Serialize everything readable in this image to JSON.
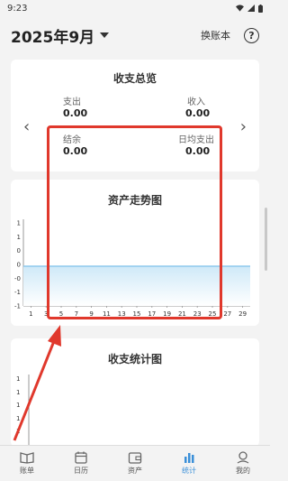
{
  "status_bar": {
    "time": "9:23",
    "icons": [
      "wifi-icon",
      "signal-icon",
      "battery-icon"
    ]
  },
  "header": {
    "title": "2025年9月",
    "switch_book": "换账本",
    "help_icon": "?"
  },
  "summary": {
    "title": "收支总览",
    "expense_label": "支出",
    "expense_value": "0.00",
    "income_label": "收入",
    "income_value": "0.00",
    "balance_label": "结余",
    "balance_value": "0.00",
    "daily_label": "日均支出",
    "daily_value": "0.00",
    "prev_arrow": "‹",
    "next_arrow": "›"
  },
  "trend": {
    "title": "资产走势图"
  },
  "stat": {
    "title": "收支统计图",
    "y_ticks": [
      "1",
      "1",
      "1",
      "1",
      "1"
    ]
  },
  "chart_data": {
    "type": "area",
    "title": "资产走势图",
    "x": [
      1,
      3,
      5,
      7,
      9,
      11,
      13,
      15,
      17,
      19,
      21,
      23,
      25,
      27,
      29
    ],
    "y_ticks": [
      "1",
      "1",
      "0",
      "0",
      "-0",
      "-1",
      "-1"
    ],
    "values": [
      0,
      0,
      0,
      0,
      0,
      0,
      0,
      0,
      0,
      0,
      0,
      0,
      0,
      0,
      0
    ],
    "ylim": [
      -1,
      1
    ],
    "grid": false,
    "colors": {
      "line": "#8ec9ee",
      "fill_top": "#cfe9f8",
      "fill_bottom": "#ffffff"
    }
  },
  "bottom_nav": [
    {
      "label": "账单",
      "icon": "book-icon"
    },
    {
      "label": "日历",
      "icon": "calendar-icon"
    },
    {
      "label": "资产",
      "icon": "wallet-icon"
    },
    {
      "label": "统计",
      "icon": "chart-icon"
    },
    {
      "label": "我的",
      "icon": "user-icon"
    }
  ],
  "colors": {
    "accent": "#3a8fd8",
    "annotation": "#e0382c"
  }
}
